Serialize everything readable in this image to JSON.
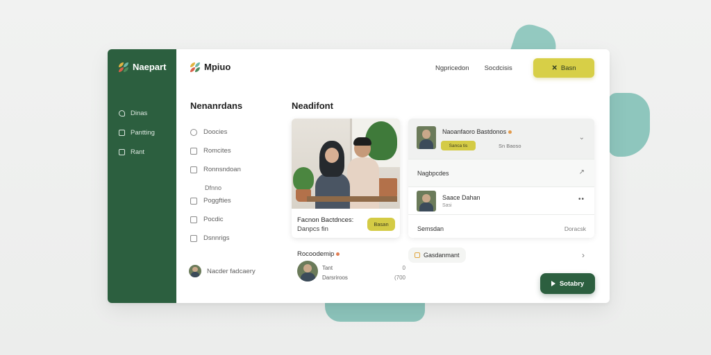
{
  "sidebar": {
    "logo": "Naepart",
    "items": [
      {
        "label": "Dinas",
        "icon": "home-icon"
      },
      {
        "label": "Pantting",
        "icon": "calendar-icon"
      },
      {
        "label": "Rant",
        "icon": "mail-icon"
      }
    ]
  },
  "header": {
    "brand": "Mpiuo",
    "nav": [
      "Ngpricedon",
      "Socdcisis"
    ],
    "primary_button": "Basn"
  },
  "left_menu": {
    "title": "Nenanrdans",
    "items": [
      {
        "label": "Doocies",
        "icon": "circle-icon"
      },
      {
        "label": "Romcites",
        "icon": "square-icon"
      },
      {
        "label": "Ronnsndoan",
        "icon": "check-icon"
      }
    ],
    "subheading": "Dfnno",
    "subitems": [
      {
        "label": "Poggfties",
        "icon": "square-icon"
      },
      {
        "label": "Pocdic",
        "icon": "check-icon"
      },
      {
        "label": "Dsnnrigs",
        "icon": "edit-icon"
      }
    ],
    "user": "Nacder fadcaery"
  },
  "main": {
    "title": "Neadifont",
    "photo_card": {
      "caption_title": "Facnon Bactdnces:",
      "caption_sub": "Danpcs fin",
      "chip": "Basan"
    },
    "panel": {
      "head_name": "Naoanfaoro Bastdonos",
      "head_chip": "Sanca tis",
      "head_meta": "Sn Baoso",
      "row1_label": "Nagbpcdes",
      "person_name": "Saace Dahan",
      "person_sub": "Sasi",
      "row3_label": "Semsdan",
      "row3_right": "Doracsk"
    },
    "bottom_left": {
      "title": "Rocoodemip",
      "line1": "Tant",
      "line2": "Darsriroos",
      "right1": "0",
      "right2": "(700"
    },
    "tag": "Gasdanmant",
    "dark_button": "Sotabry"
  },
  "colors": {
    "sidebar_green": "#2c5f3f",
    "accent_yellow": "#d7cf47",
    "blob_teal": "#8cc5bd"
  }
}
